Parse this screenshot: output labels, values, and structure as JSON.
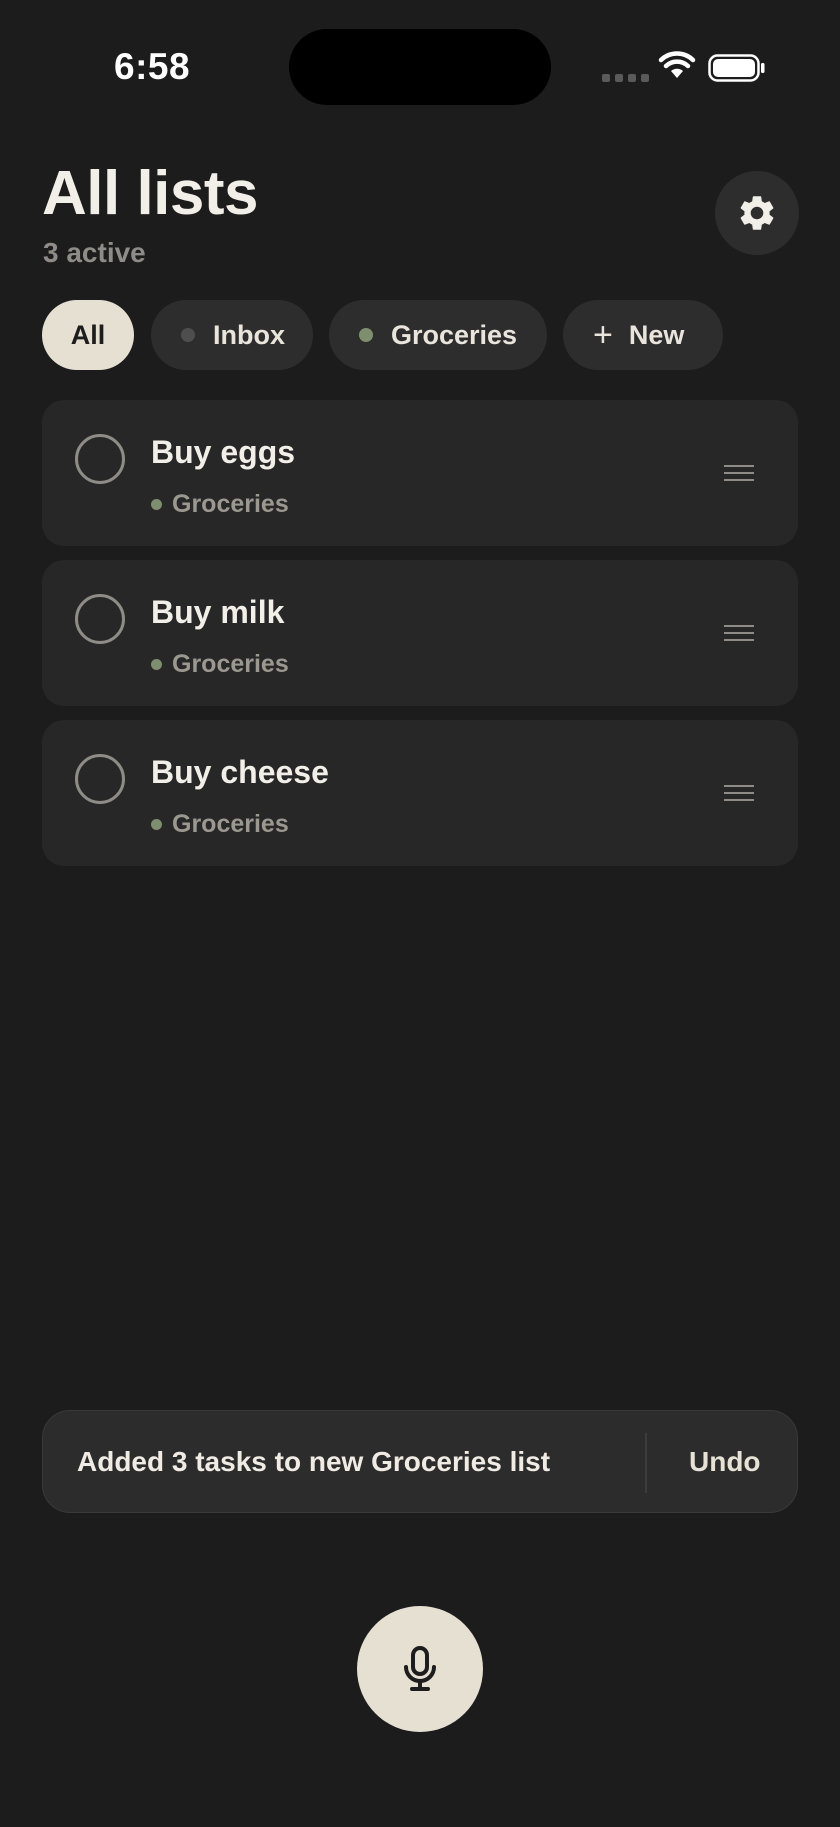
{
  "status_bar": {
    "time": "6:58",
    "icons": [
      "signal-icon",
      "wifi-icon",
      "battery-icon"
    ]
  },
  "header": {
    "title": "All lists",
    "subtitle": "3 active",
    "settings_icon": "gear-icon"
  },
  "chips": [
    {
      "label": "All",
      "active": true
    },
    {
      "label": "Inbox",
      "dot_color": "#4f4e4f"
    },
    {
      "label": "Groceries",
      "dot_color": "#7e8f70"
    },
    {
      "label": "New",
      "icon": "plus-icon"
    }
  ],
  "tasks": [
    {
      "title": "Buy eggs",
      "list": "Groceries",
      "list_color": "#7e8f70"
    },
    {
      "title": "Buy milk",
      "list": "Groceries",
      "list_color": "#7e8f70"
    },
    {
      "title": "Buy cheese",
      "list": "Groceries",
      "list_color": "#7e8f70"
    }
  ],
  "toast": {
    "message": "Added 3 tasks to new Groceries list",
    "action": "Undo"
  },
  "mic": {
    "icon": "microphone-icon"
  },
  "colors": {
    "background": "#1d1c1d",
    "card": "#282728",
    "accent": "#e6e0d2",
    "groceries": "#7e8f70"
  }
}
